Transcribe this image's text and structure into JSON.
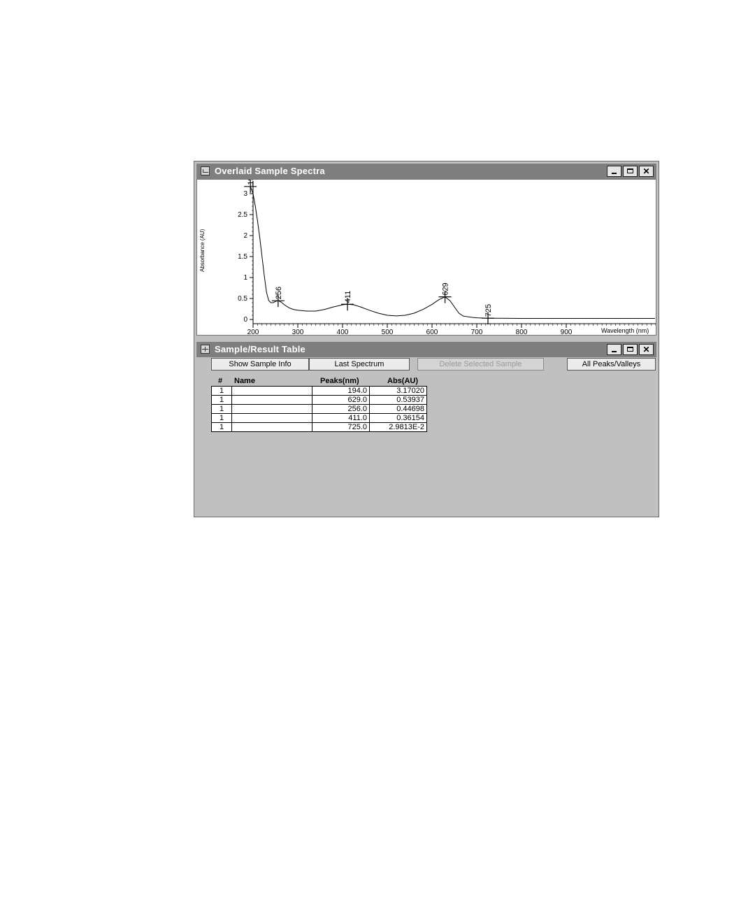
{
  "spectra_window": {
    "title": "Overlaid Sample Spectra",
    "icon": "chart-icon"
  },
  "table_window": {
    "title": "Sample/Result Table",
    "icon": "table-icon"
  },
  "toolbar": {
    "show_sample_info": "Show Sample Info",
    "last_spectrum": "Last Spectrum",
    "delete_selected_sample": "Delete Selected Sample",
    "all_peaks_valleys": "All Peaks/Valleys"
  },
  "table": {
    "headers": [
      "#",
      "Name",
      "Peaks(nm)",
      "Abs(AU)"
    ],
    "rows": [
      {
        "num": "1",
        "name": "",
        "peak": "194.0",
        "abs": "3.17020"
      },
      {
        "num": "1",
        "name": "",
        "peak": "629.0",
        "abs": "0.53937"
      },
      {
        "num": "1",
        "name": "",
        "peak": "256.0",
        "abs": "0.44698"
      },
      {
        "num": "1",
        "name": "",
        "peak": "411.0",
        "abs": "0.36154"
      },
      {
        "num": "1",
        "name": "",
        "peak": "725.0",
        "abs": "2.9813E-2"
      }
    ]
  },
  "chart_data": {
    "type": "line",
    "title": "",
    "xlabel": "Wavelength (nm)",
    "ylabel": "Absorbance (AU)",
    "xlim": [
      200,
      1100
    ],
    "ylim": [
      0,
      3.2
    ],
    "x_ticks": [
      "200",
      "300",
      "400",
      "500",
      "600",
      "700",
      "800",
      "900"
    ],
    "y_ticks": [
      "0",
      "0.5",
      "1",
      "1.5",
      "2",
      "2.5",
      "3"
    ],
    "grid": false,
    "series": [
      {
        "x": [
          194,
          200,
          205,
          210,
          215,
          220,
          225,
          230,
          235,
          240,
          245,
          250,
          256,
          262,
          270,
          280,
          290,
          300,
          320,
          340,
          360,
          380,
          400,
          411,
          425,
          440,
          460,
          480,
          500,
          520,
          540,
          560,
          580,
          600,
          615,
          629,
          640,
          650,
          660,
          670,
          690,
          700,
          725,
          750,
          800,
          850,
          900,
          950,
          1000,
          1050,
          1100
        ],
        "y": [
          3.17,
          3.0,
          2.7,
          2.35,
          1.95,
          1.5,
          1.05,
          0.65,
          0.45,
          0.4,
          0.4,
          0.43,
          0.447,
          0.42,
          0.35,
          0.28,
          0.24,
          0.22,
          0.2,
          0.2,
          0.24,
          0.3,
          0.35,
          0.362,
          0.35,
          0.3,
          0.22,
          0.15,
          0.1,
          0.085,
          0.1,
          0.15,
          0.24,
          0.36,
          0.47,
          0.539,
          0.45,
          0.3,
          0.15,
          0.08,
          0.05,
          0.04,
          0.03,
          0.03,
          0.025,
          0.025,
          0.025,
          0.025,
          0.025,
          0.025,
          0.025
        ]
      }
    ],
    "peak_markers": [
      {
        "x": 194,
        "y": 3.17,
        "label": "194"
      },
      {
        "x": 256,
        "y": 0.447,
        "label": "256"
      },
      {
        "x": 411,
        "y": 0.362,
        "label": "411"
      },
      {
        "x": 629,
        "y": 0.539,
        "label": "629"
      },
      {
        "x": 725,
        "y": 0.03,
        "label": "725"
      }
    ]
  }
}
